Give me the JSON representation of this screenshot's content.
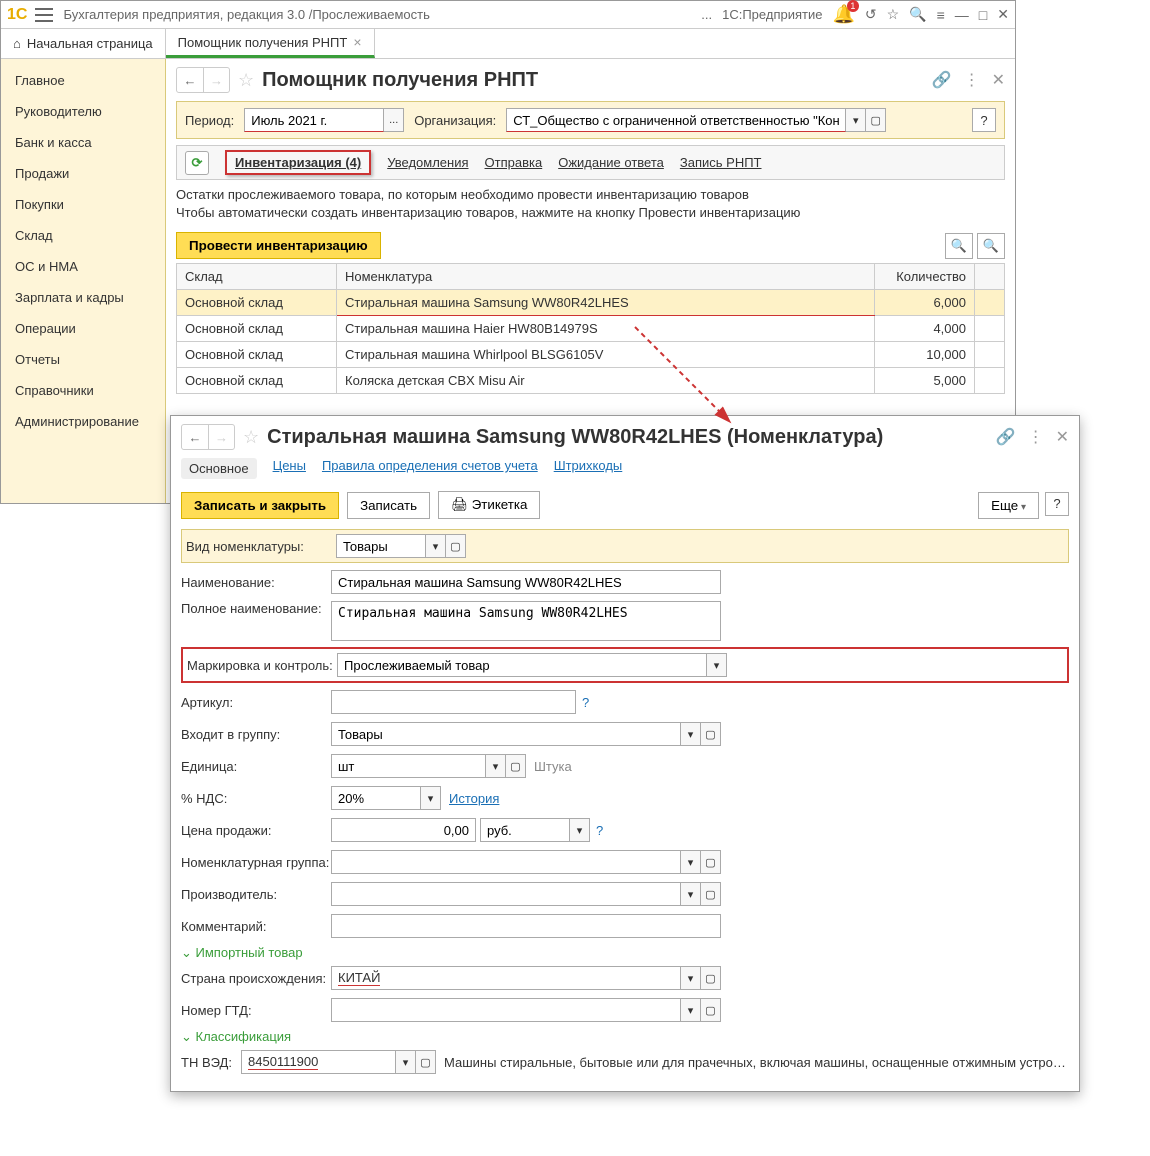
{
  "titlebar": {
    "app_title": "Бухгалтерия предприятия, редакция 3.0 /Прослеживаемость",
    "platform": "1С:Предприятие",
    "badge": "1"
  },
  "tabs": {
    "home": "Начальная страница",
    "active": "Помощник получения РНПТ"
  },
  "sidebar": {
    "items": [
      "Главное",
      "Руководителю",
      "Банк и касса",
      "Продажи",
      "Покупки",
      "Склад",
      "ОС и НМА",
      "Зарплата и кадры",
      "Операции",
      "Отчеты",
      "Справочники",
      "Администрирование"
    ]
  },
  "page": {
    "title": "Помощник получения РНПТ",
    "period_label": "Период:",
    "period_value": "Июль 2021 г.",
    "org_label": "Организация:",
    "org_value": "СТ_Общество с ограниченной ответственностью \"Конкорд\"",
    "tabs": {
      "inv": "Инвентаризация (4)",
      "notif": "Уведомления",
      "send": "Отправка",
      "wait": "Ожидание ответа",
      "rec": "Запись РНПТ"
    },
    "desc1": "Остатки прослеживаемого товара, по которым необходимо провести инвентаризацию товаров",
    "desc2": "Чтобы автоматически создать инвентаризацию товаров, нажмите на кнопку Провести инвентаризацию",
    "inv_btn": "Провести инвентаризацию",
    "cols": {
      "sklad": "Склад",
      "nomen": "Номенклатура",
      "qty": "Количество"
    },
    "rows": [
      {
        "sklad": "Основной склад",
        "nomen": "Стиральная машина Samsung WW80R42LHES",
        "qty": "6,000"
      },
      {
        "sklad": "Основной склад",
        "nomen": "Стиральная машина Haier HW80B14979S",
        "qty": "4,000"
      },
      {
        "sklad": "Основной склад",
        "nomen": "Стиральная машина Whirlpool BLSG6105V",
        "qty": "10,000"
      },
      {
        "sklad": "Основной склад",
        "nomen": "Коляска детская CBX Misu Air",
        "qty": "5,000"
      }
    ]
  },
  "overlay": {
    "title": "Стиральная машина Samsung WW80R42LHES (Номенклатура)",
    "tabs": {
      "main": "Основное",
      "prices": "Цены",
      "rules": "Правила определения счетов учета",
      "barcodes": "Штрихкоды"
    },
    "btn_save_close": "Записать и закрыть",
    "btn_save": "Записать",
    "btn_label": "Этикетка",
    "btn_more": "Еще",
    "labels": {
      "vid": "Вид номенклатуры:",
      "name": "Наименование:",
      "full": "Полное наименование:",
      "mark": "Маркировка и контроль:",
      "art": "Артикул:",
      "group": "Входит в группу:",
      "unit": "Единица:",
      "vat": "% НДС:",
      "price": "Цена продажи:",
      "ngroup": "Номенклатурная группа:",
      "manuf": "Производитель:",
      "comment": "Комментарий:",
      "country": "Страна происхождения:",
      "gtd": "Номер ГТД:",
      "tnved": "ТН ВЭД:"
    },
    "values": {
      "vid": "Товары",
      "name": "Стиральная машина Samsung WW80R42LHES",
      "full": "Стиральная машина Samsung WW80R42LHES",
      "mark": "Прослеживаемый товар",
      "group": "Товары",
      "unit": "шт",
      "unit_hint": "Штука",
      "vat": "20%",
      "vat_hist": "История",
      "price": "0,00",
      "currency": "руб.",
      "country": "КИТАЙ",
      "tnved": "8450111900",
      "tnved_desc": "Машины стиральные, бытовые или для прачечных, включая машины, оснащенные отжимным устройством..."
    },
    "sections": {
      "import": "Импортный товар",
      "classif": "Классификация"
    }
  }
}
